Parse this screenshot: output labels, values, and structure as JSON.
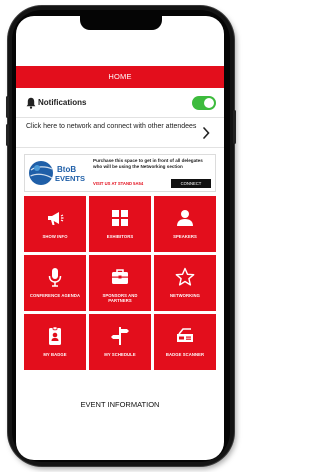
{
  "header": {
    "title": "HOME"
  },
  "notifications": {
    "label": "Notifications",
    "enabled": true
  },
  "network": {
    "text": "Click here to network and connect with other attendees"
  },
  "ad": {
    "logo_line1": "BtoB",
    "logo_line2": "EVENTS",
    "text": "Purchase this space to get in front of all delegates who will be using the Networking section",
    "visit": "VISIT US AT STAND 5A54",
    "connect": "CONNECT"
  },
  "tiles": [
    {
      "label": "SHOW INFO",
      "icon": "megaphone-icon"
    },
    {
      "label": "EXHIBITORS",
      "icon": "grid-icon"
    },
    {
      "label": "SPEAKERS",
      "icon": "person-icon"
    },
    {
      "label": "CONFERENCE AGENDA",
      "icon": "microphone-icon"
    },
    {
      "label": "SPONSORS AND PARTNERS",
      "icon": "briefcase-icon"
    },
    {
      "label": "NETWORKING",
      "icon": "star-icon"
    },
    {
      "label": "MY BADGE",
      "icon": "badge-icon"
    },
    {
      "label": "MY SCHEDULE",
      "icon": "signpost-icon"
    },
    {
      "label": "BADGE SCANNER",
      "icon": "scanner-icon"
    }
  ],
  "footer": {
    "label": "EVENT INFORMATION"
  },
  "colors": {
    "primary": "#e30e1c",
    "toggle_on": "#3dbb3d"
  }
}
